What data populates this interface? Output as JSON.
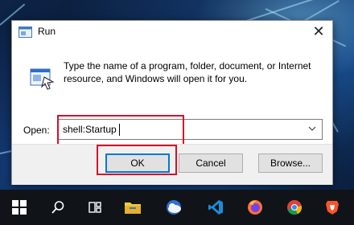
{
  "dialog": {
    "title": "Run",
    "description": "Type the name of a program, folder, document, or Internet resource, and Windows will open it for you.",
    "open_label": "Open:",
    "open_value": "shell:Startup",
    "buttons": {
      "ok": "OK",
      "cancel": "Cancel",
      "browse": "Browse..."
    },
    "close_glyph": "✕",
    "dropdown_glyph": "⌵"
  },
  "taskbar": {
    "items": [
      {
        "icon": "windows-start-icon"
      },
      {
        "icon": "search-icon"
      },
      {
        "icon": "task-view-icon"
      },
      {
        "icon": "file-explorer-icon"
      },
      {
        "icon": "weather-icon"
      },
      {
        "icon": "vscode-icon"
      },
      {
        "icon": "firefox-icon"
      },
      {
        "icon": "chrome-icon"
      },
      {
        "icon": "brave-icon"
      }
    ]
  },
  "colors": {
    "highlight": "#d4102a",
    "ok_focus": "#0078d7",
    "taskbar": "#101418"
  }
}
